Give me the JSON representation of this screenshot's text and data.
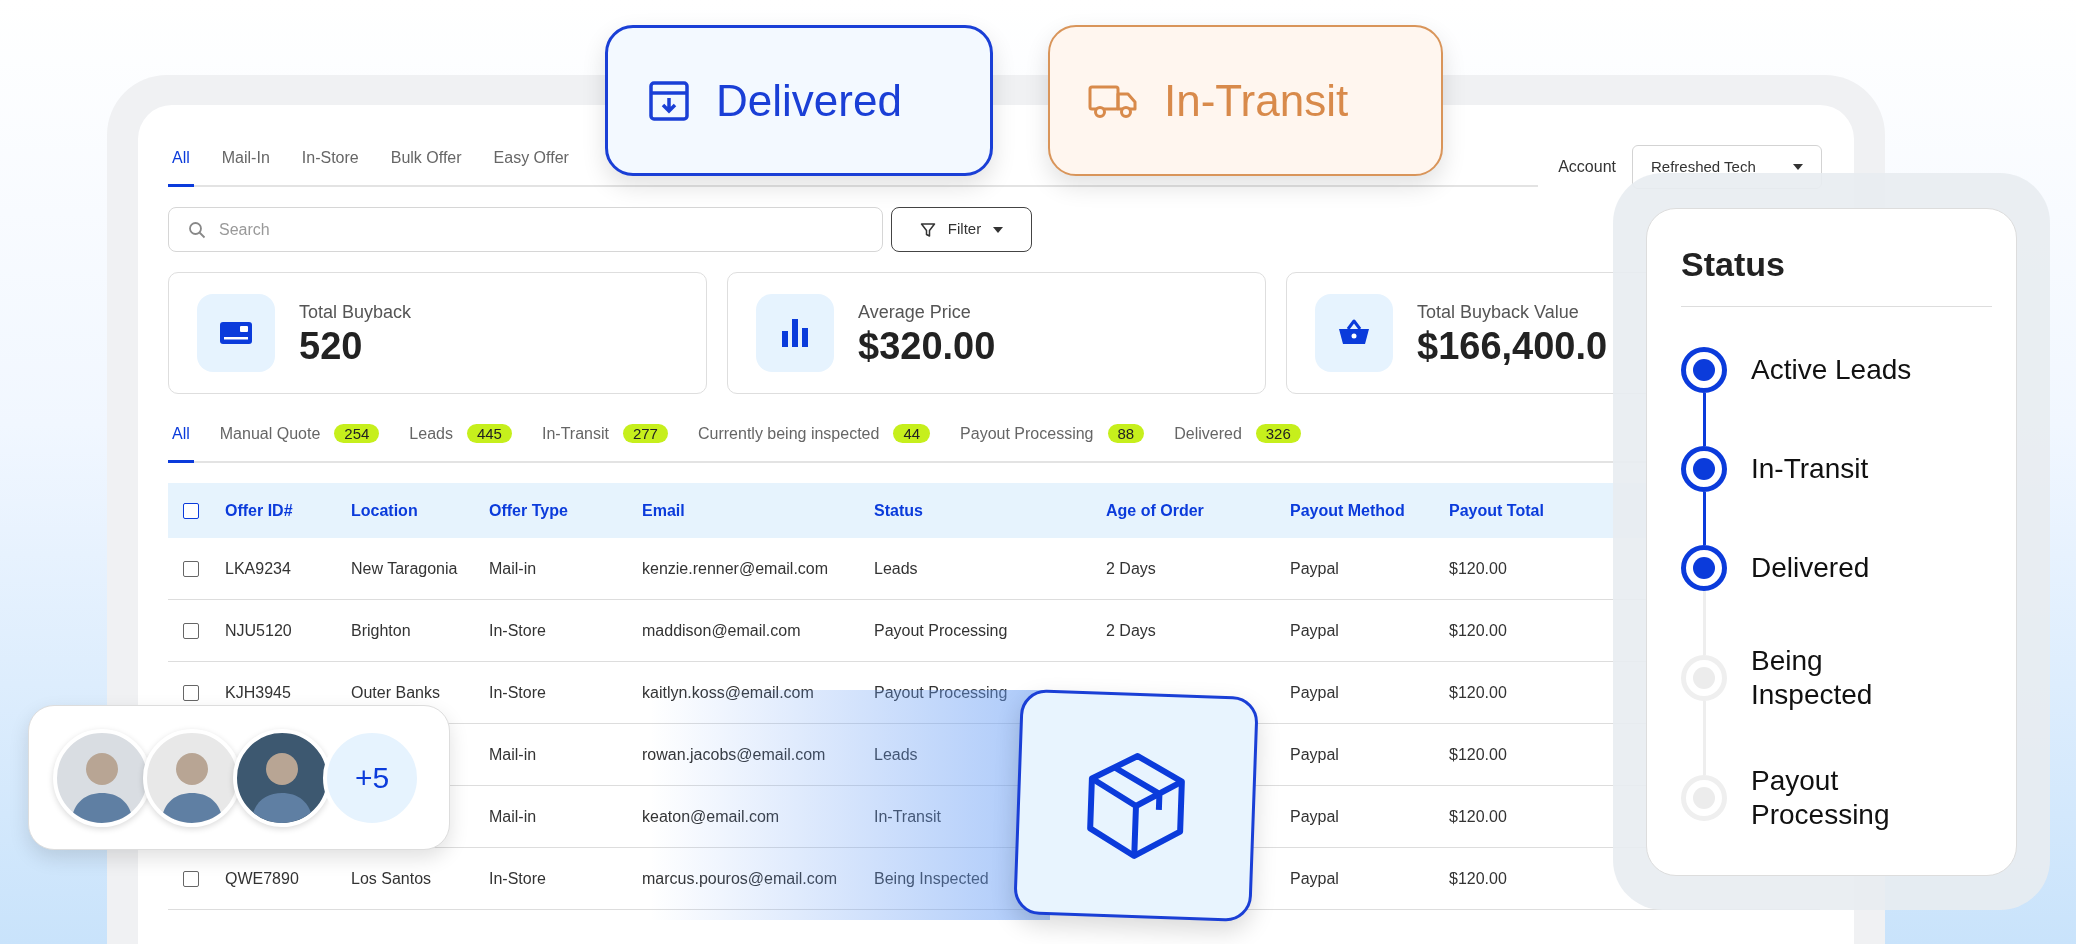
{
  "top_tabs": [
    {
      "label": "All",
      "selected": true
    },
    {
      "label": "Mail-In",
      "selected": false
    },
    {
      "label": "In-Store",
      "selected": false
    },
    {
      "label": "Bulk Offer",
      "selected": false
    },
    {
      "label": "Easy Offer",
      "selected": false
    }
  ],
  "account": {
    "label": "Account",
    "value": "Refreshed Tech"
  },
  "search": {
    "placeholder": "Search"
  },
  "filter": {
    "label": "Filter"
  },
  "stats": [
    {
      "label": "Total Buyback",
      "value": "520"
    },
    {
      "label": "Average Price",
      "value": "$320.00"
    },
    {
      "label": "Total Buyback Value",
      "value": "$166,400.0"
    }
  ],
  "status_tabs": [
    {
      "label": "All",
      "selected": true
    },
    {
      "label": "Manual Quote",
      "count": "254",
      "selected": false
    },
    {
      "label": "Leads",
      "count": "445",
      "selected": false
    },
    {
      "label": "In-Transit",
      "count": "277",
      "selected": false
    },
    {
      "label": "Currently being inspected",
      "count": "44",
      "selected": false
    },
    {
      "label": "Payout Processing",
      "count": "88",
      "selected": false
    },
    {
      "label": "Delivered",
      "count": "326",
      "selected": false
    }
  ],
  "table": {
    "header_checked": false,
    "columns": [
      "Offer ID#",
      "Location",
      "Offer Type",
      "Email",
      "Status",
      "Age of Order",
      "Payout Method",
      "Payout Total"
    ],
    "rows": [
      {
        "checked": false,
        "cells": [
          "LKA9234",
          "New Taragonia",
          "Mail-in",
          "kenzie.renner@email.com",
          "Leads",
          "2 Days",
          "Paypal",
          "$120.00"
        ]
      },
      {
        "checked": false,
        "cells": [
          "NJU5120",
          "Brighton",
          "In-Store",
          "maddison@email.com",
          "Payout Processing",
          "2 Days",
          "Paypal",
          "$120.00"
        ]
      },
      {
        "checked": false,
        "cells": [
          "KJH3945",
          "Outer Banks",
          "In-Store",
          "kaitlyn.koss@email.com",
          "Payout Processing",
          null,
          "Paypal",
          "$120.00"
        ]
      },
      {
        "cells": [
          null,
          null,
          "Mail-in",
          "rowan.jacobs@email.com",
          "Leads",
          null,
          "Paypal",
          "$120.00"
        ]
      },
      {
        "cells": [
          null,
          null,
          "Mail-in",
          "keaton@email.com",
          "In-Transit",
          null,
          "Paypal",
          "$120.00"
        ]
      },
      {
        "checked": false,
        "cells": [
          "QWE7890",
          "Los Santos",
          "In-Store",
          "marcus.pouros@email.com",
          "Being Inspected",
          null,
          "Paypal",
          "$120.00"
        ]
      }
    ]
  },
  "delivered_card": {
    "label": "Delivered"
  },
  "transit_card": {
    "label": "In-Transit"
  },
  "status_panel": {
    "title": "Status",
    "steps": [
      {
        "label": "Active Leads",
        "active": true
      },
      {
        "label": "In-Transit",
        "active": true
      },
      {
        "label": "Delivered",
        "active": true
      },
      {
        "label": "Being Inspected",
        "active": false
      },
      {
        "label": "Payout Processing",
        "active": false
      }
    ]
  },
  "avatar_group": {
    "avatars": [
      {
        "color": "#d9dde2"
      },
      {
        "color": "#e8e8e8"
      },
      {
        "color": "#3d5870"
      }
    ],
    "more": "+5"
  }
}
